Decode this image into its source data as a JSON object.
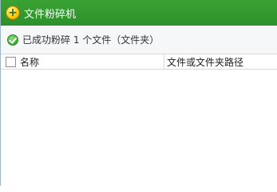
{
  "window": {
    "title": "文件粉碎机",
    "app_icon": "shredder-app-icon"
  },
  "status": {
    "icon": "success-check-icon",
    "text": "已成功粉碎 1 个文件（文件夹）"
  },
  "table": {
    "columns": {
      "name": "名称",
      "path": "文件或文件夹路径"
    },
    "rows": []
  },
  "colors": {
    "titlebar": "#2b9129",
    "status_background": "#f6f7f8"
  }
}
